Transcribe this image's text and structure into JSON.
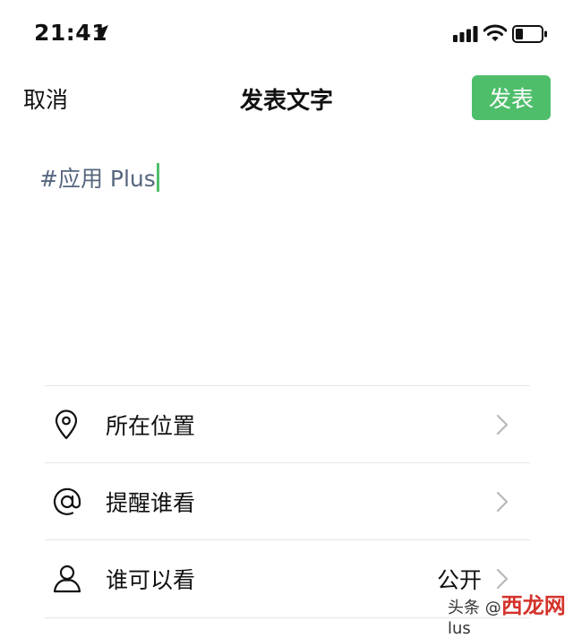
{
  "status_bar": {
    "time": "21:41",
    "icons": [
      "location-arrow-icon",
      "signal-icon",
      "wifi-icon",
      "battery-icon"
    ]
  },
  "nav": {
    "cancel_label": "取消",
    "title": "发表文字",
    "publish_label": "发表",
    "publish_color": "#4fbe6b"
  },
  "compose": {
    "text": "#应用 Plus",
    "text_color": "#56667e"
  },
  "options": [
    {
      "icon": "location-pin-icon",
      "label": "所在位置",
      "value": ""
    },
    {
      "icon": "at-sign-icon",
      "label": "提醒谁看",
      "value": ""
    },
    {
      "icon": "person-icon",
      "label": "谁可以看",
      "value": "公开"
    }
  ],
  "watermark": {
    "text_left": "头条 @",
    "text_red": "西龙网",
    "text_right": "lus"
  }
}
